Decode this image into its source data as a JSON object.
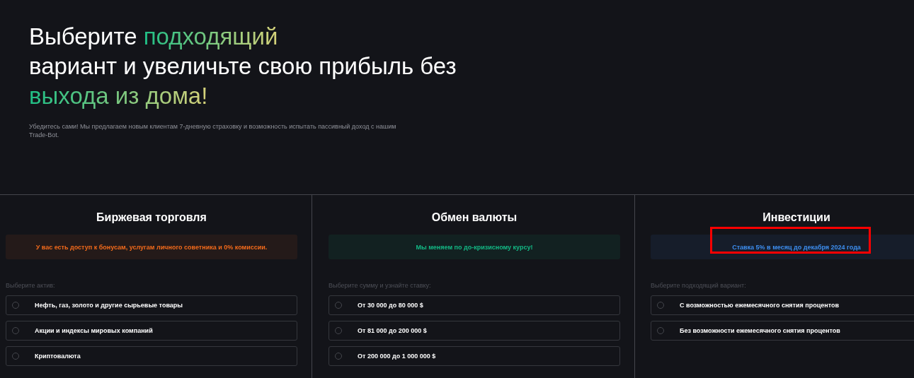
{
  "hero": {
    "heading_lines": [
      [
        {
          "text": "Выберите ",
          "accent": false
        },
        {
          "text": "подходящий",
          "accent": true
        }
      ],
      [
        {
          "text": "вариант и увеличьте свою прибыль без",
          "accent": false
        }
      ],
      [
        {
          "text": "выхода из дома!",
          "accent": true
        }
      ]
    ],
    "subtitle": "Убедитесь сами! Мы предлагаем новым клиентам 7-дневную страховку и возможность испытать пассивный доход с нашим Trade-Bot."
  },
  "cards": [
    {
      "title": "Биржевая торговля",
      "notice": {
        "text": "У вас есть доступ к бонусам, услугам личного советника и 0% комиссии.",
        "color": "#f26a1b",
        "highlighted": false
      },
      "prompt": "Выберите актив:",
      "options": [
        {
          "label": "Нефть, газ, золото и другие сырьевые товары",
          "selected": false
        },
        {
          "label": "Акции и индексы мировых компаний",
          "selected": false
        },
        {
          "label": "Криптовалюта",
          "selected": false
        }
      ]
    },
    {
      "title": "Обмен валюты",
      "notice": {
        "text": "Мы меняем по до-кризисному курсу!",
        "color": "#13b985",
        "highlighted": false
      },
      "prompt": "Выберите сумму и узнайте ставку:",
      "options": [
        {
          "label": "От 30 000 до 80 000 $",
          "selected": false
        },
        {
          "label": "От 81 000 до 200 000 $",
          "selected": false
        },
        {
          "label": "От 200 000 до 1 000 000 $",
          "selected": false
        }
      ]
    },
    {
      "title": "Инвестиции",
      "notice": {
        "text": "Ставка 5% в месяц до декабря 2024 года",
        "color": "#3d8ef0",
        "highlighted": true
      },
      "prompt": "Выберите подходящий вариант:",
      "options": [
        {
          "label": "С возможностью ежемесячного снятия процентов",
          "selected": false
        },
        {
          "label": "Без возможности ежемесячного снятия процентов",
          "selected": false
        }
      ]
    }
  ]
}
